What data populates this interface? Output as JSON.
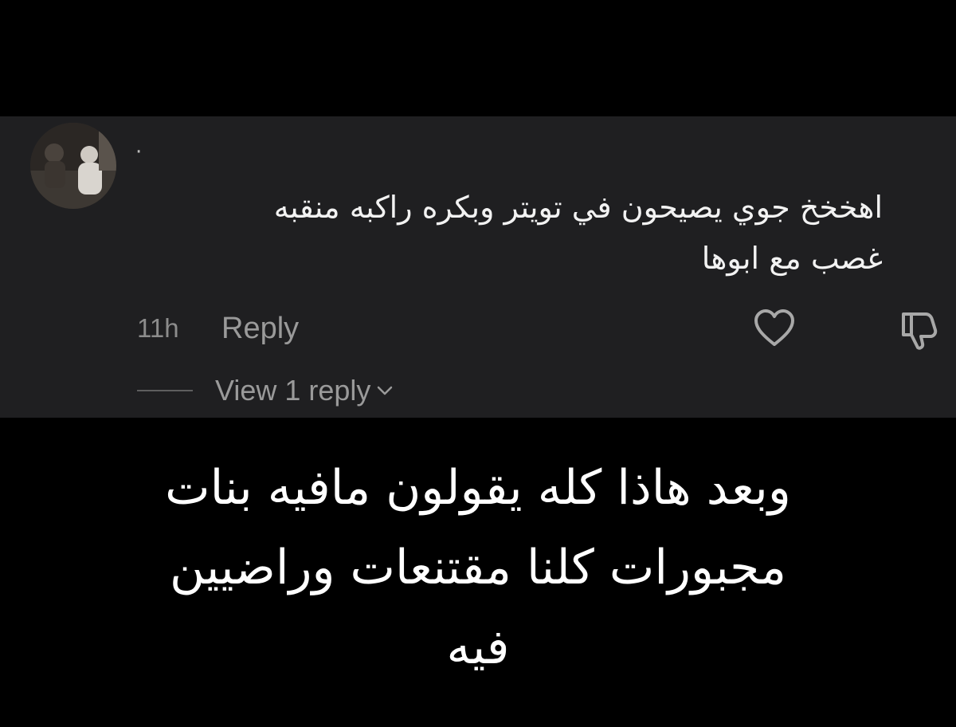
{
  "comment": {
    "username": "·",
    "text_line_1": "اهخخخ جوي يصيحون في تويتر وبكره راكبه منقبه",
    "text_line_2": "غصب مع ابوها",
    "timestamp": "11h",
    "reply_label": "Reply",
    "view_replies_label": "View 1 reply",
    "icons": {
      "avatar": "profile-photo",
      "like": "heart-outline-icon",
      "dislike": "thumbs-down-outline-icon",
      "expand": "chevron-down-icon"
    }
  },
  "caption": {
    "line_1": "وبعد هاذا كله يقولون مافيه بنات",
    "line_2": "مجبورات كلنا مقتنعات وراضيين",
    "line_3": "فيه"
  },
  "colors": {
    "background": "#000000",
    "card": "#1f1f21",
    "primary_text": "#f2f2f2",
    "secondary_text": "#9a9a9a"
  }
}
